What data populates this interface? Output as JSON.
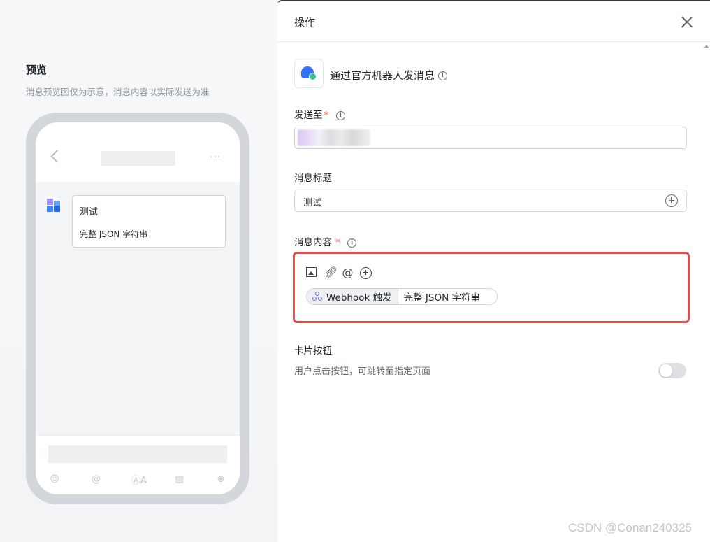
{
  "preview": {
    "title": "预览",
    "subtitle": "消息预览图仅为示意，消息内容以实际发送为准",
    "card_title": "测试",
    "card_body": "完整 JSON 字符串",
    "header_more": "···"
  },
  "drawer": {
    "title": "操作",
    "action_name": "通过官方机器人发消息",
    "send_to_label": "发送至",
    "required_mark": "*",
    "title_label": "消息标题",
    "title_value": "测试",
    "content_label": "消息内容",
    "chip_source": "Webhook 触发",
    "chip_field": "完整 JSON 字符串",
    "card_button_label": "卡片按钮",
    "card_button_desc": "用户点击按钮，可跳转至指定页面",
    "card_button_enabled": false
  },
  "toolbar_icons": [
    "image-icon",
    "link-icon",
    "at-icon",
    "plus-icon"
  ],
  "colors": {
    "accent_blue": "#3370ff",
    "accent_green": "#34c38f",
    "highlight_red": "#e04f4f",
    "required_red": "#f54a45"
  },
  "watermark": "CSDN @Conan240325"
}
